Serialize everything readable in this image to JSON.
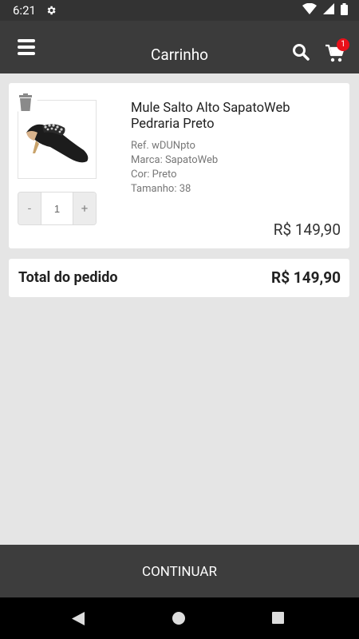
{
  "status_bar": {
    "time": "6:21"
  },
  "app_bar": {
    "title": "Carrinho",
    "cart_badge": "1"
  },
  "cart_item": {
    "name": "Mule Salto Alto SapatoWeb Pedraria Preto",
    "ref": "Ref. wDUNpto",
    "brand": "Marca: SapatoWeb",
    "color": "Cor: Preto",
    "size": "Tamanho: 38",
    "minus_label": "-",
    "plus_label": "+",
    "quantity": "1",
    "price": "R$ 149,90"
  },
  "order_total": {
    "label": "Total do pedido",
    "value": "R$ 149,90"
  },
  "continue_label": "CONTINUAR",
  "colors": {
    "app_bar": "#3b3b3b",
    "badge": "#e8101a",
    "background": "#e5e5e5"
  },
  "icons": {
    "menu": "hamburger-menu-icon",
    "search": "search-icon",
    "cart": "shopping-cart-icon",
    "trash": "trash-icon",
    "settings": "gear-icon",
    "wifi": "wifi-icon",
    "signal": "cell-signal-icon",
    "battery": "battery-icon"
  }
}
